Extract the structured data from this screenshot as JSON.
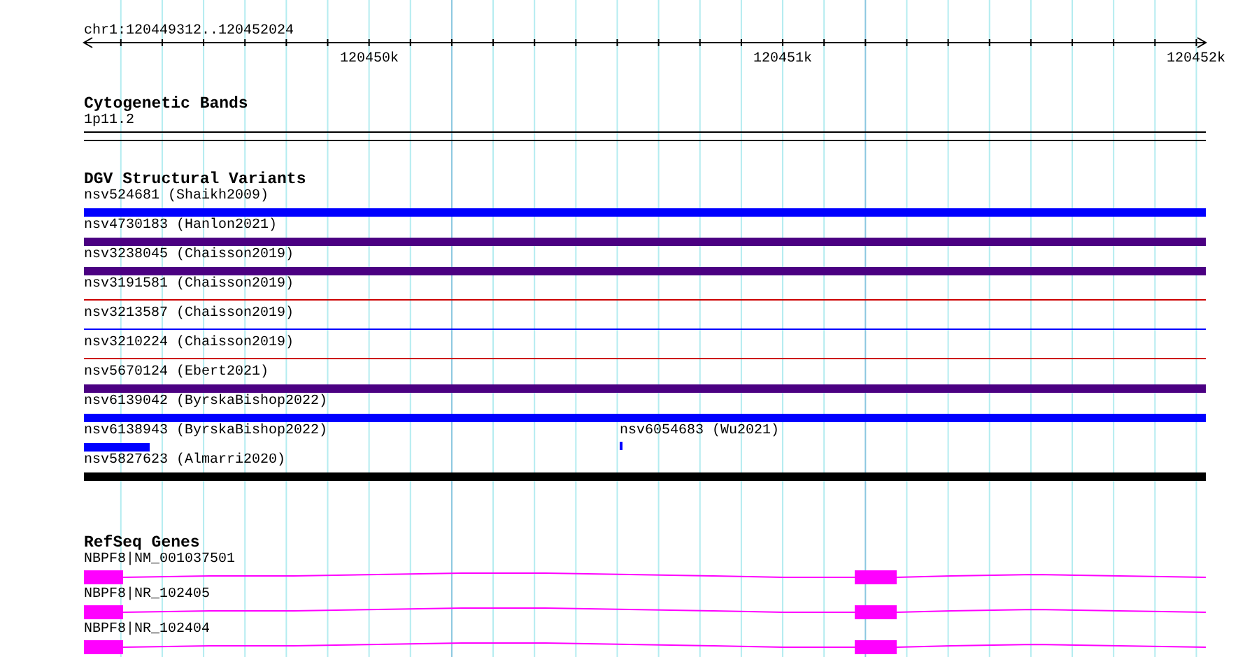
{
  "ruler": {
    "position": "chr1:120449312..120452024",
    "tick_labels": [
      "120450k",
      "120451k",
      "120452k"
    ]
  },
  "cytogenetic_bands": {
    "title": "Cytogenetic Bands",
    "band": "1p11.2"
  },
  "dgv": {
    "title": "DGV Structural Variants",
    "rows": [
      {
        "items": [
          {
            "label": "nsv524681 (Shaikh2009)",
            "kind": "thick",
            "color": "#0000ff"
          }
        ]
      },
      {
        "items": [
          {
            "label": "nsv4730183 (Hanlon2021)",
            "kind": "thick",
            "color": "#4b0082"
          }
        ]
      },
      {
        "items": [
          {
            "label": "nsv3238045 (Chaisson2019)",
            "kind": "thick",
            "color": "#4b0082"
          }
        ]
      },
      {
        "items": [
          {
            "label": "nsv3191581 (Chaisson2019)",
            "kind": "thin",
            "color": "#cc0000"
          }
        ]
      },
      {
        "items": [
          {
            "label": "nsv3213587 (Chaisson2019)",
            "kind": "thin",
            "color": "#0000ff"
          }
        ]
      },
      {
        "items": [
          {
            "label": "nsv3210224 (Chaisson2019)",
            "kind": "thin",
            "color": "#cc0000"
          }
        ]
      },
      {
        "items": [
          {
            "label": "nsv5670124 (Ebert2021)",
            "kind": "thick",
            "color": "#4b0082"
          }
        ]
      },
      {
        "items": [
          {
            "label": "nsv6139042 (ByrskaBishop2022)",
            "kind": "thick",
            "color": "#0000ff"
          }
        ]
      },
      {
        "items": [
          {
            "label": "nsv6138943 (ByrskaBishop2022)",
            "kind": "short",
            "color": "#0000ff"
          },
          {
            "label": "nsv6054683 (Wu2021)",
            "kind": "tick",
            "color": "#0000ff"
          }
        ]
      },
      {
        "items": [
          {
            "label": "nsv5827623 (Almarri2020)",
            "kind": "thick",
            "color": "#000000"
          }
        ]
      }
    ]
  },
  "refseq_genes": {
    "title": "RefSeq Genes",
    "transcripts": [
      {
        "label": "NBPF8|NM_001037501"
      },
      {
        "label": "NBPF8|NR_102405"
      },
      {
        "label": "NBPF8|NR_102404"
      }
    ]
  }
}
